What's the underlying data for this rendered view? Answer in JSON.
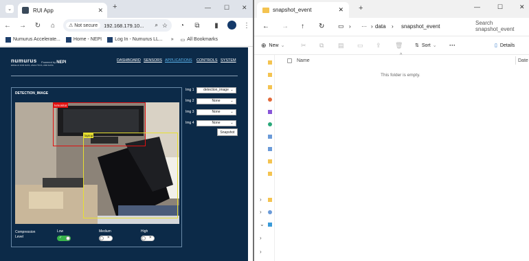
{
  "chrome": {
    "tab_title": "RUI App",
    "address": "192.168.179.10...",
    "not_secure": "Not secure",
    "bookmarks": [
      {
        "label": "Numurus Accelerate..."
      },
      {
        "label": "Home - NEPI"
      },
      {
        "label": "Log In - Numurus LL..."
      }
    ],
    "bookmarks_overflow": "»",
    "all_bookmarks": "All Bookmarks"
  },
  "rui": {
    "logo": "numurus",
    "logo_tagline": "EDGE AI FOR DATA, ANALYTICS, AND DATA",
    "powered_by": "Powered by",
    "nepi": "NEPI",
    "menu": {
      "dashboard": "DASHBOARD",
      "sensors": "SENSORS",
      "applications": "APPLICATIONS",
      "controls": "CONTROLS",
      "system": "SYSTEM"
    },
    "panel_title": "DETECTION_IMAGE",
    "detections": [
      {
        "label": "tvmonitor",
        "color": "#e01010"
      },
      {
        "label": "laptop",
        "color": "#e8e030"
      }
    ],
    "compression_label": "Compression Level",
    "options": {
      "low": {
        "label": "Low",
        "on": true
      },
      "medium": {
        "label": "Medium",
        "on": false
      },
      "high": {
        "label": "High",
        "on": false
      }
    },
    "img_selects": [
      {
        "label": "Img 1",
        "value": "detection_image"
      },
      {
        "label": "Img 2",
        "value": "None"
      },
      {
        "label": "Img 3",
        "value": "None"
      },
      {
        "label": "Img 4",
        "value": "None"
      }
    ],
    "snapshot": "Snapshot"
  },
  "explorer": {
    "tab_title": "snapshot_event",
    "breadcrumb": [
      "data",
      "snapshot_event"
    ],
    "search_placeholder": "Search snapshot_event",
    "cmd_new": "New",
    "cmd_sort": "Sort",
    "cmd_more": "···",
    "cmd_details": "Details",
    "col_name": "Name",
    "col_date": "Date",
    "empty_text": "This folder is empty."
  }
}
